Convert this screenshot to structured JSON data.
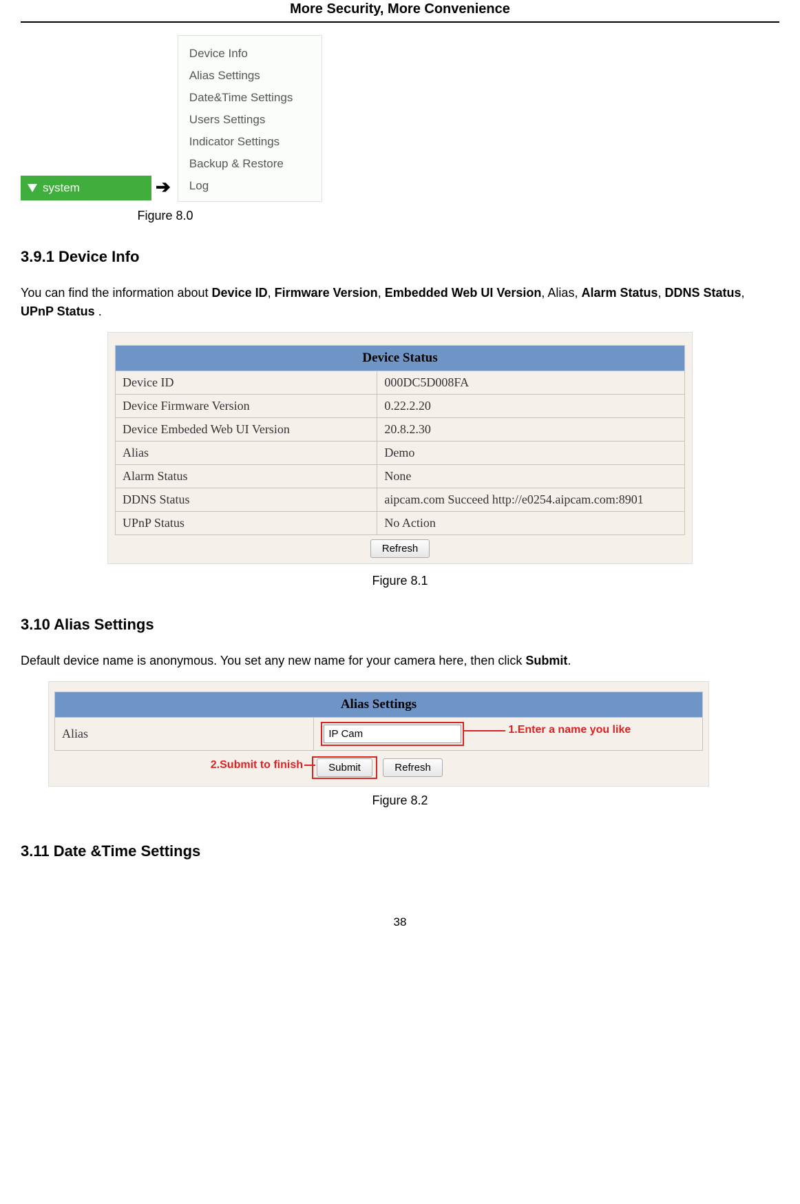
{
  "header": {
    "title": "More Security, More Convenience"
  },
  "fig80": {
    "system_label": "system",
    "arrow": "➔",
    "menu": [
      "Device Info",
      "Alias Settings",
      "Date&Time Settings",
      "Users Settings",
      "Indicator Settings",
      "Backup & Restore",
      "Log"
    ],
    "caption": "Figure 8.0"
  },
  "sec391": {
    "heading": "3.9.1 Device Info",
    "p_pre": "You can find the information about ",
    "b1": "Device ID",
    "c1": ", ",
    "b2": "Firmware Version",
    "c2": ", ",
    "b3": "Embedded Web UI Version",
    "c3": ", Alias, ",
    "b4": "Alarm Status",
    "c4": ", ",
    "b5": "DDNS Status",
    "c5": ", ",
    "b6": "UPnP Status",
    "c6": " ."
  },
  "status": {
    "title": "Device Status",
    "rows": [
      {
        "label": "Device ID",
        "value": "000DC5D008FA"
      },
      {
        "label": "Device Firmware Version",
        "value": "0.22.2.20"
      },
      {
        "label": "Device Embeded Web UI Version",
        "value": "20.8.2.30"
      },
      {
        "label": "Alias",
        "value": "Demo"
      },
      {
        "label": "Alarm Status",
        "value": "None"
      },
      {
        "label": "DDNS Status",
        "value": "aipcam.com  Succeed  http://e0254.aipcam.com:8901"
      },
      {
        "label": "UPnP Status",
        "value": "No Action"
      }
    ],
    "refresh": "Refresh",
    "caption": "Figure 8.1"
  },
  "sec310": {
    "heading": "3.10 Alias Settings",
    "p_pre": "Default device name is anonymous. You set any new name for your camera here, then click ",
    "b1": "Submit",
    "c1": "."
  },
  "alias": {
    "title": "Alias Settings",
    "label": "Alias",
    "value": "IP Cam",
    "note1": "1.Enter a name you like",
    "note2": "2.Submit to finish",
    "submit": "Submit",
    "refresh": "Refresh",
    "caption": "Figure 8.2"
  },
  "sec311": {
    "heading": "3.11 Date &Time Settings"
  },
  "page_number": "38"
}
